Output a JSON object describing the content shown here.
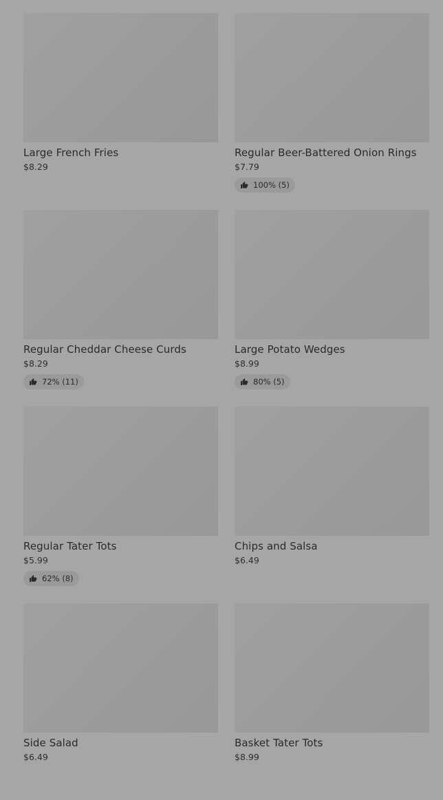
{
  "items": [
    {
      "name": "Large French Fries",
      "price": "$8.29",
      "rating": ""
    },
    {
      "name": "Regular Beer-Battered Onion Rings",
      "price": "$7.79",
      "rating": "100% (5)"
    },
    {
      "name": "Regular Cheddar Cheese Curds",
      "price": "$8.29",
      "rating": "72% (11)"
    },
    {
      "name": "Large Potato Wedges",
      "price": "$8.99",
      "rating": "80% (5)"
    },
    {
      "name": "Regular Tater Tots",
      "price": "$5.99",
      "rating": "62% (8)"
    },
    {
      "name": "Chips and Salsa",
      "price": "$6.49",
      "rating": ""
    },
    {
      "name": "Side Salad",
      "price": "$6.49",
      "rating": ""
    },
    {
      "name": "Basket Tater Tots",
      "price": "$8.99",
      "rating": ""
    }
  ],
  "icons": {
    "rating": "thumbs-up-icon"
  }
}
